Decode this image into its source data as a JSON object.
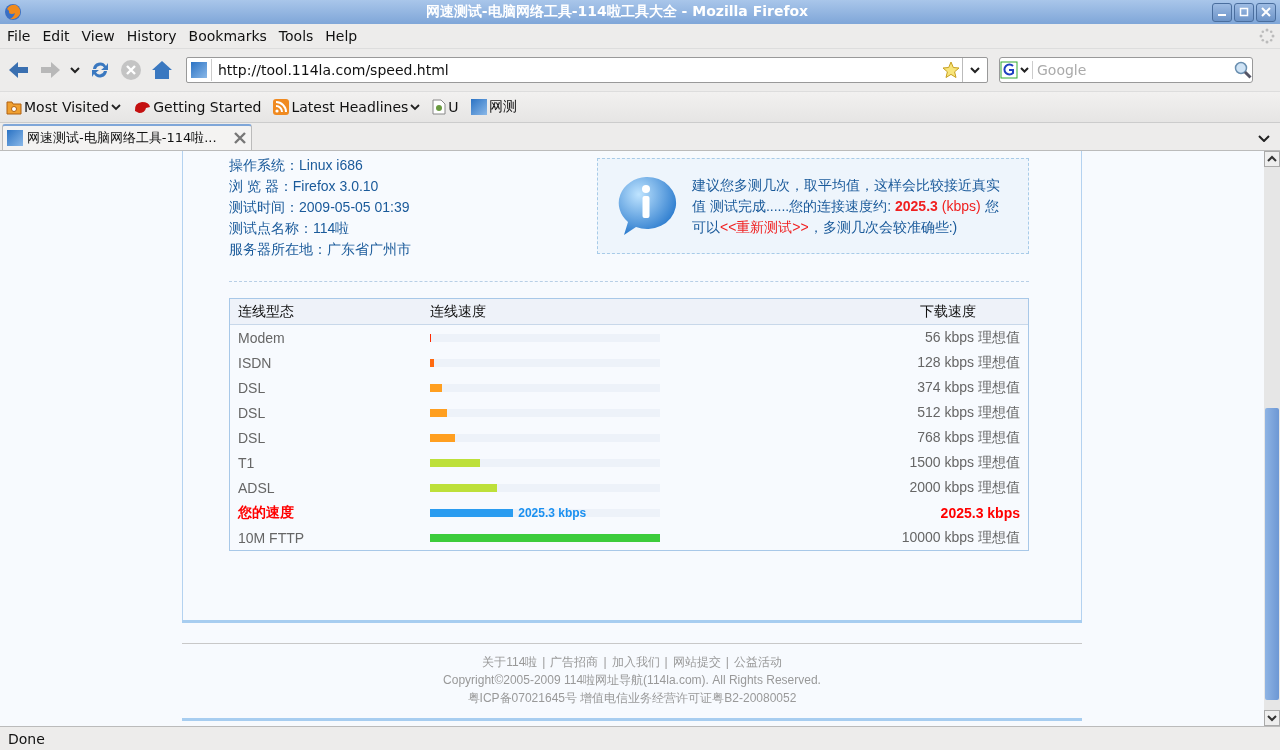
{
  "window": {
    "title": "网速测试-电脑网络工具-114啦工具大全 - Mozilla Firefox"
  },
  "menu": [
    "File",
    "Edit",
    "View",
    "History",
    "Bookmarks",
    "Tools",
    "Help"
  ],
  "address": {
    "value": "http://tool.114la.com/speed.html"
  },
  "search": {
    "placeholder": "Google"
  },
  "bookmarks": [
    {
      "label": "Most Visited",
      "kind": "folder"
    },
    {
      "label": "Getting Started",
      "kind": "start"
    },
    {
      "label": "Latest Headlines",
      "kind": "feed"
    },
    {
      "label": "U",
      "kind": "page"
    },
    {
      "label": "网测",
      "kind": "site"
    }
  ],
  "tabs": [
    {
      "label": "网速测试-电脑网络工具-114啦...",
      "selected": true
    }
  ],
  "info_lines": [
    "操作系统：Linux i686",
    "浏 览 器：Firefox 3.0.10",
    "测试时间：2009-05-05 01:39",
    "测试点名称：114啦",
    "服务器所在地：广东省广州市"
  ],
  "notice": [
    {
      "kind": "text",
      "text": "建议您多测几次，取平均值，这样会比较接近真实值 测试完成......您的连接速度约: "
    },
    {
      "kind": "speed",
      "text": "2025.3"
    },
    {
      "kind": "unit",
      "text": " (kbps) "
    },
    {
      "kind": "text",
      "text": "您可以"
    },
    {
      "kind": "link",
      "text": "<<重新测试>>"
    },
    {
      "kind": "text",
      "text": "，多测几次会较准确些:)"
    }
  ],
  "table": {
    "columns": [
      "连线型态",
      "连线速度",
      "下载速度"
    ],
    "rows": [
      {
        "kind": "ideal",
        "type": "Modem",
        "level": 0.005,
        "color": "#ff2a00",
        "speed": "56 kbps 理想值"
      },
      {
        "kind": "ideal",
        "type": "ISDN",
        "level": 0.017,
        "color": "#ff6a10",
        "speed": "128 kbps 理想值"
      },
      {
        "kind": "ideal",
        "type": "DSL",
        "level": 0.052,
        "color": "#ff9f20",
        "speed": "374 kbps 理想值"
      },
      {
        "kind": "ideal",
        "type": "DSL",
        "level": 0.074,
        "color": "#ff9f20",
        "speed": "512 kbps 理想值"
      },
      {
        "kind": "ideal",
        "type": "DSL",
        "level": 0.109,
        "color": "#ff9f20",
        "speed": "768 kbps 理想值"
      },
      {
        "kind": "ideal",
        "type": "T1",
        "level": 0.218,
        "color": "#bde03a",
        "speed": "1500 kbps 理想值"
      },
      {
        "kind": "ideal",
        "type": "ADSL",
        "level": 0.293,
        "color": "#bde03a",
        "speed": "2000 kbps 理想值"
      },
      {
        "kind": "yours",
        "type": "您的速度",
        "level": 0.362,
        "color": "#2a9cf0",
        "bar_label": "2025.3 kbps",
        "speed": "2025.3 kbps"
      },
      {
        "kind": "ideal",
        "type": "10M FTTP",
        "level": 1,
        "color": "#3ccc3c",
        "speed": "10000 kbps 理想值"
      }
    ]
  },
  "footer": {
    "separator": "|",
    "links": [
      "关于114啦",
      "广告招商",
      "加入我们",
      "网站提交",
      "公益活动"
    ],
    "copyright": "Copyright©2005-2009 114啦网址导航(114la.com). All Rights Reserved.",
    "license": "粤ICP备07021645号 增值电信业务经营许可证粤B2-20080052"
  },
  "status_bar": "Done"
}
